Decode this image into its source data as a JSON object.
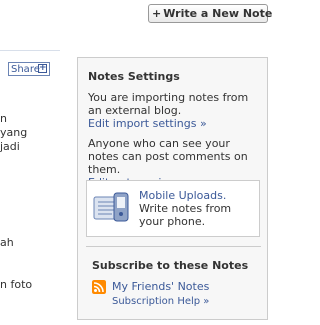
{
  "header": {
    "write_note_label": "Write a New Note"
  },
  "left_partial": {
    "share_label": "Share",
    "lines": [
      "n",
      "yang",
      "jadi",
      "ah",
      "n foto"
    ]
  },
  "panel": {
    "title": "Notes Settings",
    "import_text": "You are importing notes from an external blog.",
    "import_link": "Edit import settings »",
    "privacy_text": "Anyone who can see your notes can post comments on them.",
    "privacy_link": "Edit notes privacy »",
    "mobile": {
      "link": "Mobile Uploads.",
      "text": "Write notes from your phone."
    },
    "subscribe": {
      "title": "Subscribe to these Notes",
      "friends_link": "My Friends' Notes",
      "help_link": "Subscription Help »"
    }
  },
  "colors": {
    "link": "#3b5998",
    "rss": "#ff8a00"
  }
}
